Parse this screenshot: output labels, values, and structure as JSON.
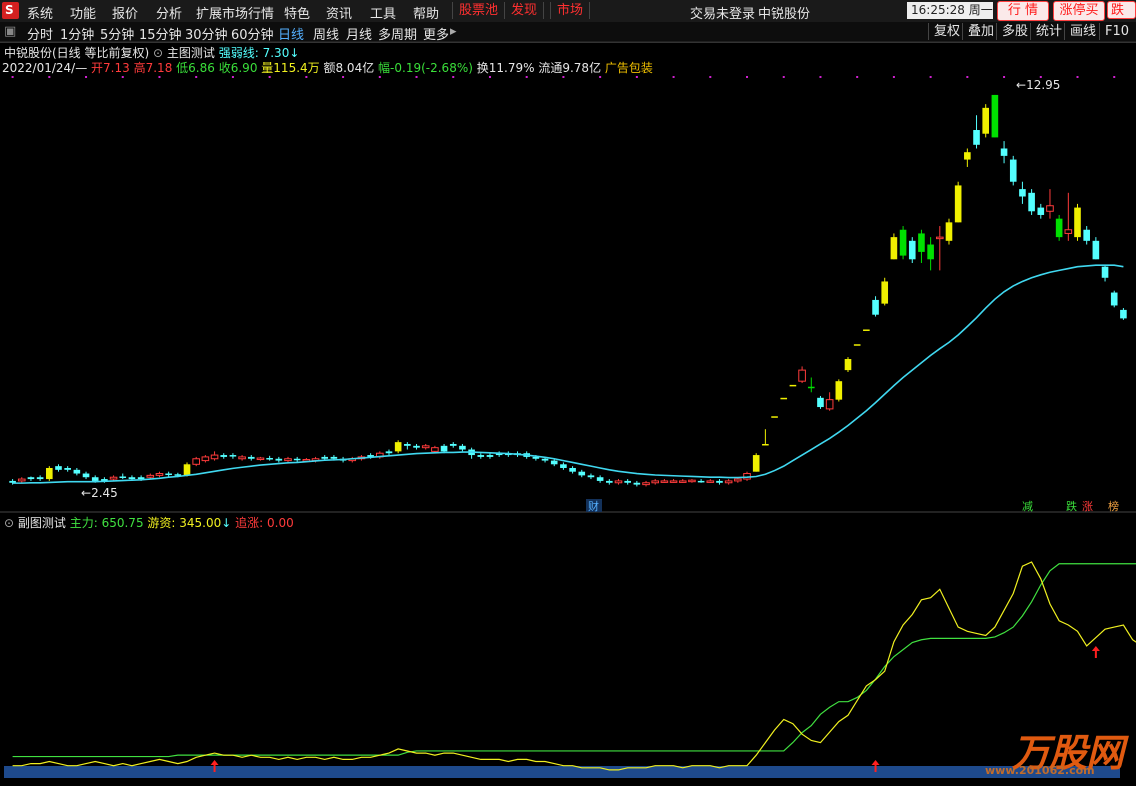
{
  "menu": {
    "logo_glyph": "S",
    "items": [
      "系统",
      "功能",
      "报价",
      "分析",
      "扩展市场行情",
      "特色",
      "资讯",
      "工具",
      "帮助"
    ],
    "red_buttons": [
      "股票池",
      "发现",
      "市场"
    ],
    "center_title": "交易未登录",
    "stock_title": "中锐股份",
    "time": "16:25:28 周一",
    "pills": [
      "行 情",
      "涨停买",
      "跌停"
    ]
  },
  "tabs": {
    "periods": [
      "分时",
      "1分钟",
      "5分钟",
      "15分钟",
      "30分钟",
      "60分钟",
      "日线",
      "周线",
      "月线",
      "多周期",
      "更多"
    ],
    "active": "日线",
    "right": [
      "复权",
      "叠加",
      "多股",
      "统计",
      "画线",
      "F10"
    ]
  },
  "main_info": {
    "name": "中锐股份(日线 等比前复权)",
    "indicator": "主图测试",
    "weak_label": "强弱线: 7.30",
    "arrow": "↓",
    "date": "2022/01/24/—",
    "open": "开7.13",
    "high": "高7.18",
    "low": "低6.86",
    "close": "收6.90",
    "volume": "量115.4万",
    "amount": "额8.04亿",
    "change": "幅-0.19(-2.68%)",
    "turnover": "换11.79%",
    "float": "流通9.78亿",
    "ad": "广告包装"
  },
  "price_labels": {
    "high": "12.95",
    "low": "2.45"
  },
  "markers": {
    "cai": "财",
    "jian": "减",
    "die": "跌",
    "zhang": "涨",
    "bang": "榜"
  },
  "sub_info": {
    "name": "副图测试",
    "zhuli": "主力: 650.75",
    "youzi": "游资: 345.00",
    "arrow": "↓",
    "zhuizhang": "追涨: 0.00"
  },
  "watermark": {
    "text": "万股网",
    "url": "www.201062.com"
  },
  "colors": {
    "up_red": "#ff3b3b",
    "down_cyan": "#54ffff",
    "yellow_candle": "#f0f000",
    "green_candle": "#00e000",
    "ma_line": "#40d8f0",
    "yellow_line": "#f0f020",
    "green_line": "#40e040",
    "blue_band": "#1e4a8c"
  },
  "chart_data": {
    "type": "candlestick",
    "title": "中锐股份 日线",
    "y_range": [
      2.2,
      13.3
    ],
    "candles": [
      {
        "o": 2.45,
        "c": 2.5,
        "h": 2.55,
        "l": 2.4,
        "k": "d"
      },
      {
        "o": 2.5,
        "c": 2.55,
        "h": 2.6,
        "l": 2.45,
        "k": "u"
      },
      {
        "o": 2.55,
        "c": 2.6,
        "h": 2.62,
        "l": 2.5,
        "k": "d"
      },
      {
        "o": 2.6,
        "c": 2.55,
        "h": 2.65,
        "l": 2.5,
        "k": "d"
      },
      {
        "o": 2.55,
        "c": 2.85,
        "h": 2.9,
        "l": 2.5,
        "k": "y"
      },
      {
        "o": 2.8,
        "c": 2.9,
        "h": 2.95,
        "l": 2.75,
        "k": "d"
      },
      {
        "o": 2.85,
        "c": 2.8,
        "h": 2.9,
        "l": 2.75,
        "k": "d"
      },
      {
        "o": 2.8,
        "c": 2.7,
        "h": 2.85,
        "l": 2.65,
        "k": "d"
      },
      {
        "o": 2.7,
        "c": 2.6,
        "h": 2.75,
        "l": 2.55,
        "k": "d"
      },
      {
        "o": 2.6,
        "c": 2.5,
        "h": 2.65,
        "l": 2.45,
        "k": "d"
      },
      {
        "o": 2.5,
        "c": 2.55,
        "h": 2.6,
        "l": 2.45,
        "k": "d"
      },
      {
        "o": 2.55,
        "c": 2.6,
        "h": 2.65,
        "l": 2.5,
        "k": "u"
      },
      {
        "o": 2.6,
        "c": 2.62,
        "h": 2.7,
        "l": 2.55,
        "k": "d"
      },
      {
        "o": 2.6,
        "c": 2.55,
        "h": 2.65,
        "l": 2.5,
        "k": "d"
      },
      {
        "o": 2.55,
        "c": 2.6,
        "h": 2.65,
        "l": 2.5,
        "k": "d"
      },
      {
        "o": 2.6,
        "c": 2.65,
        "h": 2.7,
        "l": 2.55,
        "k": "u"
      },
      {
        "o": 2.65,
        "c": 2.7,
        "h": 2.75,
        "l": 2.6,
        "k": "u"
      },
      {
        "o": 2.7,
        "c": 2.68,
        "h": 2.75,
        "l": 2.62,
        "k": "d"
      },
      {
        "o": 2.68,
        "c": 2.65,
        "h": 2.72,
        "l": 2.6,
        "k": "d"
      },
      {
        "o": 2.65,
        "c": 2.95,
        "h": 3.0,
        "l": 2.62,
        "k": "y"
      },
      {
        "o": 2.95,
        "c": 3.1,
        "h": 3.15,
        "l": 2.9,
        "k": "u"
      },
      {
        "o": 3.05,
        "c": 3.15,
        "h": 3.2,
        "l": 3.0,
        "k": "u"
      },
      {
        "o": 3.1,
        "c": 3.2,
        "h": 3.3,
        "l": 3.05,
        "k": "u"
      },
      {
        "o": 3.15,
        "c": 3.2,
        "h": 3.25,
        "l": 3.1,
        "k": "d"
      },
      {
        "o": 3.2,
        "c": 3.18,
        "h": 3.25,
        "l": 3.1,
        "k": "d"
      },
      {
        "o": 3.15,
        "c": 3.1,
        "h": 3.2,
        "l": 3.05,
        "k": "u"
      },
      {
        "o": 3.1,
        "c": 3.15,
        "h": 3.2,
        "l": 3.05,
        "k": "d"
      },
      {
        "o": 3.12,
        "c": 3.1,
        "h": 3.15,
        "l": 3.05,
        "k": "u"
      },
      {
        "o": 3.1,
        "c": 3.12,
        "h": 3.18,
        "l": 3.05,
        "k": "d"
      },
      {
        "o": 3.1,
        "c": 3.05,
        "h": 3.15,
        "l": 3.0,
        "k": "d"
      },
      {
        "o": 3.05,
        "c": 3.1,
        "h": 3.15,
        "l": 3.0,
        "k": "u"
      },
      {
        "o": 3.1,
        "c": 3.08,
        "h": 3.15,
        "l": 3.0,
        "k": "d"
      },
      {
        "o": 3.08,
        "c": 3.05,
        "h": 3.12,
        "l": 3.0,
        "k": "u"
      },
      {
        "o": 3.05,
        "c": 3.1,
        "h": 3.15,
        "l": 3.0,
        "k": "u"
      },
      {
        "o": 3.1,
        "c": 3.15,
        "h": 3.2,
        "l": 3.05,
        "k": "d"
      },
      {
        "o": 3.15,
        "c": 3.1,
        "h": 3.2,
        "l": 3.05,
        "k": "d"
      },
      {
        "o": 3.1,
        "c": 3.05,
        "h": 3.15,
        "l": 3.0,
        "k": "d"
      },
      {
        "o": 3.05,
        "c": 3.1,
        "h": 3.15,
        "l": 3.0,
        "k": "u"
      },
      {
        "o": 3.1,
        "c": 3.15,
        "h": 3.2,
        "l": 3.05,
        "k": "u"
      },
      {
        "o": 3.15,
        "c": 3.2,
        "h": 3.25,
        "l": 3.1,
        "k": "d"
      },
      {
        "o": 3.15,
        "c": 3.25,
        "h": 3.3,
        "l": 3.1,
        "k": "u"
      },
      {
        "o": 3.25,
        "c": 3.3,
        "h": 3.35,
        "l": 3.2,
        "k": "d"
      },
      {
        "o": 3.3,
        "c": 3.55,
        "h": 3.6,
        "l": 3.25,
        "k": "y"
      },
      {
        "o": 3.5,
        "c": 3.45,
        "h": 3.55,
        "l": 3.35,
        "k": "d"
      },
      {
        "o": 3.45,
        "c": 3.4,
        "h": 3.5,
        "l": 3.35,
        "k": "d"
      },
      {
        "o": 3.4,
        "c": 3.45,
        "h": 3.5,
        "l": 3.35,
        "k": "u"
      },
      {
        "o": 3.4,
        "c": 3.3,
        "h": 3.45,
        "l": 3.25,
        "k": "u"
      },
      {
        "o": 3.3,
        "c": 3.45,
        "h": 3.5,
        "l": 3.25,
        "k": "d"
      },
      {
        "o": 3.45,
        "c": 3.5,
        "h": 3.55,
        "l": 3.4,
        "k": "d"
      },
      {
        "o": 3.45,
        "c": 3.35,
        "h": 3.5,
        "l": 3.3,
        "k": "d"
      },
      {
        "o": 3.35,
        "c": 3.2,
        "h": 3.4,
        "l": 3.1,
        "k": "d"
      },
      {
        "o": 3.2,
        "c": 3.15,
        "h": 3.25,
        "l": 3.1,
        "k": "d"
      },
      {
        "o": 3.15,
        "c": 3.2,
        "h": 3.25,
        "l": 3.1,
        "k": "d"
      },
      {
        "o": 3.2,
        "c": 3.25,
        "h": 3.3,
        "l": 3.15,
        "k": "d"
      },
      {
        "o": 3.25,
        "c": 3.2,
        "h": 3.3,
        "l": 3.15,
        "k": "d"
      },
      {
        "o": 3.2,
        "c": 3.25,
        "h": 3.3,
        "l": 3.15,
        "k": "d"
      },
      {
        "o": 3.25,
        "c": 3.15,
        "h": 3.3,
        "l": 3.1,
        "k": "d"
      },
      {
        "o": 3.15,
        "c": 3.1,
        "h": 3.2,
        "l": 3.05,
        "k": "d"
      },
      {
        "o": 3.1,
        "c": 3.05,
        "h": 3.15,
        "l": 3.0,
        "k": "d"
      },
      {
        "o": 3.05,
        "c": 2.95,
        "h": 3.1,
        "l": 2.9,
        "k": "d"
      },
      {
        "o": 2.95,
        "c": 2.85,
        "h": 3.0,
        "l": 2.8,
        "k": "d"
      },
      {
        "o": 2.85,
        "c": 2.75,
        "h": 2.9,
        "l": 2.7,
        "k": "d"
      },
      {
        "o": 2.75,
        "c": 2.65,
        "h": 2.8,
        "l": 2.6,
        "k": "d"
      },
      {
        "o": 2.65,
        "c": 2.6,
        "h": 2.7,
        "l": 2.55,
        "k": "d"
      },
      {
        "o": 2.6,
        "c": 2.5,
        "h": 2.65,
        "l": 2.45,
        "k": "d"
      },
      {
        "o": 2.5,
        "c": 2.45,
        "h": 2.55,
        "l": 2.4,
        "k": "d"
      },
      {
        "o": 2.45,
        "c": 2.5,
        "h": 2.55,
        "l": 2.4,
        "k": "u"
      },
      {
        "o": 2.5,
        "c": 2.45,
        "h": 2.55,
        "l": 2.4,
        "k": "d"
      },
      {
        "o": 2.45,
        "c": 2.4,
        "h": 2.5,
        "l": 2.35,
        "k": "d"
      },
      {
        "o": 2.4,
        "c": 2.45,
        "h": 2.5,
        "l": 2.35,
        "k": "u"
      },
      {
        "o": 2.45,
        "c": 2.5,
        "h": 2.55,
        "l": 2.4,
        "k": "u"
      },
      {
        "o": 2.48,
        "c": 2.5,
        "h": 2.55,
        "l": 2.45,
        "k": "u"
      },
      {
        "o": 2.5,
        "c": 2.48,
        "h": 2.55,
        "l": 2.45,
        "k": "u"
      },
      {
        "o": 2.48,
        "c": 2.5,
        "h": 2.55,
        "l": 2.45,
        "k": "u"
      },
      {
        "o": 2.5,
        "c": 2.52,
        "h": 2.55,
        "l": 2.45,
        "k": "u"
      },
      {
        "o": 2.5,
        "c": 2.48,
        "h": 2.55,
        "l": 2.45,
        "k": "d"
      },
      {
        "o": 2.48,
        "c": 2.5,
        "h": 2.55,
        "l": 2.45,
        "k": "u"
      },
      {
        "o": 2.5,
        "c": 2.45,
        "h": 2.55,
        "l": 2.4,
        "k": "d"
      },
      {
        "o": 2.45,
        "c": 2.5,
        "h": 2.55,
        "l": 2.4,
        "k": "u"
      },
      {
        "o": 2.5,
        "c": 2.55,
        "h": 2.6,
        "l": 2.45,
        "k": "u"
      },
      {
        "o": 2.55,
        "c": 2.7,
        "h": 2.75,
        "l": 2.5,
        "k": "u"
      },
      {
        "o": 2.75,
        "c": 3.2,
        "h": 3.25,
        "l": 2.75,
        "k": "y"
      },
      {
        "o": 3.5,
        "c": 3.5,
        "h": 3.9,
        "l": 3.5,
        "k": "y"
      },
      {
        "o": 4.25,
        "c": 4.25,
        "h": 4.25,
        "l": 4.25,
        "k": "y"
      },
      {
        "o": 4.75,
        "c": 4.75,
        "h": 4.75,
        "l": 4.75,
        "k": "y"
      },
      {
        "o": 5.1,
        "c": 5.1,
        "h": 5.1,
        "l": 5.1,
        "k": "y"
      },
      {
        "o": 5.2,
        "c": 5.5,
        "h": 5.6,
        "l": 5.15,
        "k": "u"
      },
      {
        "o": 5.05,
        "c": 5.05,
        "h": 5.3,
        "l": 4.9,
        "k": "g"
      },
      {
        "o": 4.5,
        "c": 4.75,
        "h": 4.8,
        "l": 4.45,
        "k": "d"
      },
      {
        "o": 4.45,
        "c": 4.7,
        "h": 4.9,
        "l": 4.4,
        "k": "u"
      },
      {
        "o": 4.7,
        "c": 5.2,
        "h": 5.25,
        "l": 4.65,
        "k": "y"
      },
      {
        "o": 5.5,
        "c": 5.8,
        "h": 5.85,
        "l": 5.45,
        "k": "y"
      },
      {
        "o": 6.2,
        "c": 6.2,
        "h": 6.2,
        "l": 6.2,
        "k": "y"
      },
      {
        "o": 6.6,
        "c": 6.6,
        "h": 6.6,
        "l": 6.6,
        "k": "y"
      },
      {
        "o": 7.0,
        "c": 7.4,
        "h": 7.5,
        "l": 6.95,
        "k": "d"
      },
      {
        "o": 7.3,
        "c": 7.9,
        "h": 8.0,
        "l": 7.25,
        "k": "y"
      },
      {
        "o": 8.5,
        "c": 9.1,
        "h": 9.2,
        "l": 8.5,
        "k": "y"
      },
      {
        "o": 8.6,
        "c": 9.3,
        "h": 9.4,
        "l": 8.5,
        "k": "g"
      },
      {
        "o": 9.0,
        "c": 8.5,
        "h": 9.1,
        "l": 8.4,
        "k": "d"
      },
      {
        "o": 8.7,
        "c": 9.2,
        "h": 9.3,
        "l": 8.4,
        "k": "g"
      },
      {
        "o": 8.5,
        "c": 8.9,
        "h": 9.1,
        "l": 8.2,
        "k": "g"
      },
      {
        "o": 9.1,
        "c": 9.1,
        "h": 9.4,
        "l": 8.2,
        "k": "u"
      },
      {
        "o": 9.0,
        "c": 9.5,
        "h": 9.6,
        "l": 8.9,
        "k": "y"
      },
      {
        "o": 9.5,
        "c": 10.5,
        "h": 10.6,
        "l": 9.5,
        "k": "y"
      },
      {
        "o": 11.2,
        "c": 11.4,
        "h": 11.5,
        "l": 11.0,
        "k": "y"
      },
      {
        "o": 11.6,
        "c": 12.0,
        "h": 12.4,
        "l": 11.5,
        "k": "d"
      },
      {
        "o": 11.9,
        "c": 12.6,
        "h": 12.7,
        "l": 11.8,
        "k": "y"
      },
      {
        "o": 11.8,
        "c": 12.95,
        "h": 12.95,
        "l": 11.8,
        "k": "g"
      },
      {
        "o": 11.5,
        "c": 11.3,
        "h": 11.7,
        "l": 11.1,
        "k": "d"
      },
      {
        "o": 11.2,
        "c": 10.6,
        "h": 11.3,
        "l": 10.5,
        "k": "d"
      },
      {
        "o": 10.4,
        "c": 10.2,
        "h": 10.6,
        "l": 10.0,
        "k": "d"
      },
      {
        "o": 10.3,
        "c": 9.8,
        "h": 10.4,
        "l": 9.7,
        "k": "d"
      },
      {
        "o": 9.9,
        "c": 9.7,
        "h": 10.0,
        "l": 9.6,
        "k": "d"
      },
      {
        "o": 9.8,
        "c": 9.95,
        "h": 10.4,
        "l": 9.6,
        "k": "u"
      },
      {
        "o": 9.6,
        "c": 9.1,
        "h": 9.7,
        "l": 9.0,
        "k": "g"
      },
      {
        "o": 9.3,
        "c": 9.2,
        "h": 10.3,
        "l": 9.0,
        "k": "u"
      },
      {
        "o": 9.1,
        "c": 9.9,
        "h": 10.0,
        "l": 9.0,
        "k": "y"
      },
      {
        "o": 9.3,
        "c": 9.0,
        "h": 9.4,
        "l": 8.9,
        "k": "d"
      },
      {
        "o": 9.0,
        "c": 8.5,
        "h": 9.1,
        "l": 8.5,
        "k": "d"
      },
      {
        "o": 8.3,
        "c": 8.0,
        "h": 8.35,
        "l": 7.9,
        "k": "d"
      },
      {
        "o": 7.6,
        "c": 7.25,
        "h": 7.65,
        "l": 7.2,
        "k": "d"
      },
      {
        "o": 7.13,
        "c": 6.9,
        "h": 7.18,
        "l": 6.86,
        "k": "d"
      }
    ],
    "ma": [
      2.44,
      2.44,
      2.45,
      2.45,
      2.46,
      2.47,
      2.48,
      2.48,
      2.48,
      2.48,
      2.49,
      2.5,
      2.51,
      2.52,
      2.53,
      2.55,
      2.57,
      2.6,
      2.62,
      2.65,
      2.68,
      2.72,
      2.76,
      2.8,
      2.84,
      2.87,
      2.9,
      2.93,
      2.95,
      2.97,
      2.99,
      3.0,
      3.02,
      3.04,
      3.06,
      3.07,
      3.08,
      3.1,
      3.12,
      3.14,
      3.16,
      3.18,
      3.2,
      3.22,
      3.24,
      3.25,
      3.26,
      3.27,
      3.27,
      3.28,
      3.28,
      3.27,
      3.26,
      3.25,
      3.24,
      3.22,
      3.2,
      3.17,
      3.14,
      3.1,
      3.05,
      3.0,
      2.95,
      2.9,
      2.85,
      2.8,
      2.76,
      2.73,
      2.7,
      2.68,
      2.66,
      2.65,
      2.64,
      2.63,
      2.62,
      2.61,
      2.6,
      2.6,
      2.59,
      2.59,
      2.6,
      2.62,
      2.68,
      2.78,
      2.9,
      3.05,
      3.2,
      3.35,
      3.5,
      3.65,
      3.82,
      4.0,
      4.2,
      4.4,
      4.62,
      4.85,
      5.08,
      5.3,
      5.5,
      5.7,
      5.9,
      6.08,
      6.25,
      6.45,
      6.68,
      6.92,
      7.18,
      7.42,
      7.62,
      7.78,
      7.9,
      8.0,
      8.08,
      8.15,
      8.2,
      8.25,
      8.3,
      8.32,
      8.34,
      8.34,
      8.34,
      8.3
    ],
    "sub_panel": {
      "y_range": [
        0,
        100
      ],
      "yellow": [
        3,
        3,
        4,
        4,
        5,
        4,
        3,
        3,
        4,
        5,
        4,
        3,
        4,
        3,
        4,
        5,
        6,
        5,
        4,
        5,
        7,
        8,
        9,
        8,
        8,
        7,
        8,
        7,
        7,
        6,
        7,
        6,
        7,
        7,
        6,
        7,
        6,
        6,
        7,
        7,
        8,
        9,
        11,
        10,
        9,
        9,
        8,
        9,
        9,
        8,
        7,
        6,
        6,
        6,
        5,
        6,
        6,
        5,
        5,
        4,
        3,
        3,
        2,
        2,
        2,
        1,
        1,
        2,
        2,
        2,
        3,
        3,
        3,
        2,
        3,
        3,
        3,
        2,
        3,
        3,
        3,
        8,
        14,
        20,
        25,
        23,
        18,
        15,
        14,
        19,
        24,
        27,
        34,
        41,
        44,
        48,
        62,
        70,
        75,
        82,
        83,
        87,
        78,
        69,
        67,
        66,
        65,
        69,
        77,
        85,
        98,
        100,
        92,
        80,
        72,
        70,
        67,
        60,
        64,
        68,
        69,
        70,
        63,
        60,
        48,
        35,
        30
      ],
      "green": [
        8,
        8,
        8,
        8,
        8,
        8,
        8,
        8,
        8,
        8,
        8,
        8,
        8,
        8,
        8,
        8,
        8,
        8,
        9,
        9,
        9,
        9,
        9,
        9,
        9,
        9,
        9,
        9,
        9,
        9,
        9,
        9,
        9,
        9,
        9,
        9,
        9,
        9,
        9,
        9,
        9,
        9,
        9,
        11,
        12,
        12,
        12,
        12,
        12,
        12,
        12,
        12,
        12,
        12,
        12,
        12,
        12,
        12,
        12,
        12,
        12,
        12,
        12,
        12,
        12,
        12,
        12,
        12,
        12,
        12,
        12,
        12,
        12,
        12,
        12,
        12,
        12,
        12,
        12,
        12,
        12,
        12,
        12,
        12,
        12,
        18,
        25,
        30,
        38,
        43,
        47,
        47,
        50,
        55,
        63,
        72,
        79,
        84,
        89,
        91,
        92,
        92,
        92,
        92,
        92,
        92,
        92,
        93,
        96,
        100,
        108,
        118,
        130,
        140,
        145,
        145,
        145,
        145,
        145,
        145,
        145,
        145,
        145,
        145,
        145,
        145,
        145
      ],
      "band_level": 5,
      "up_arrows": [
        22,
        94,
        118
      ]
    }
  }
}
